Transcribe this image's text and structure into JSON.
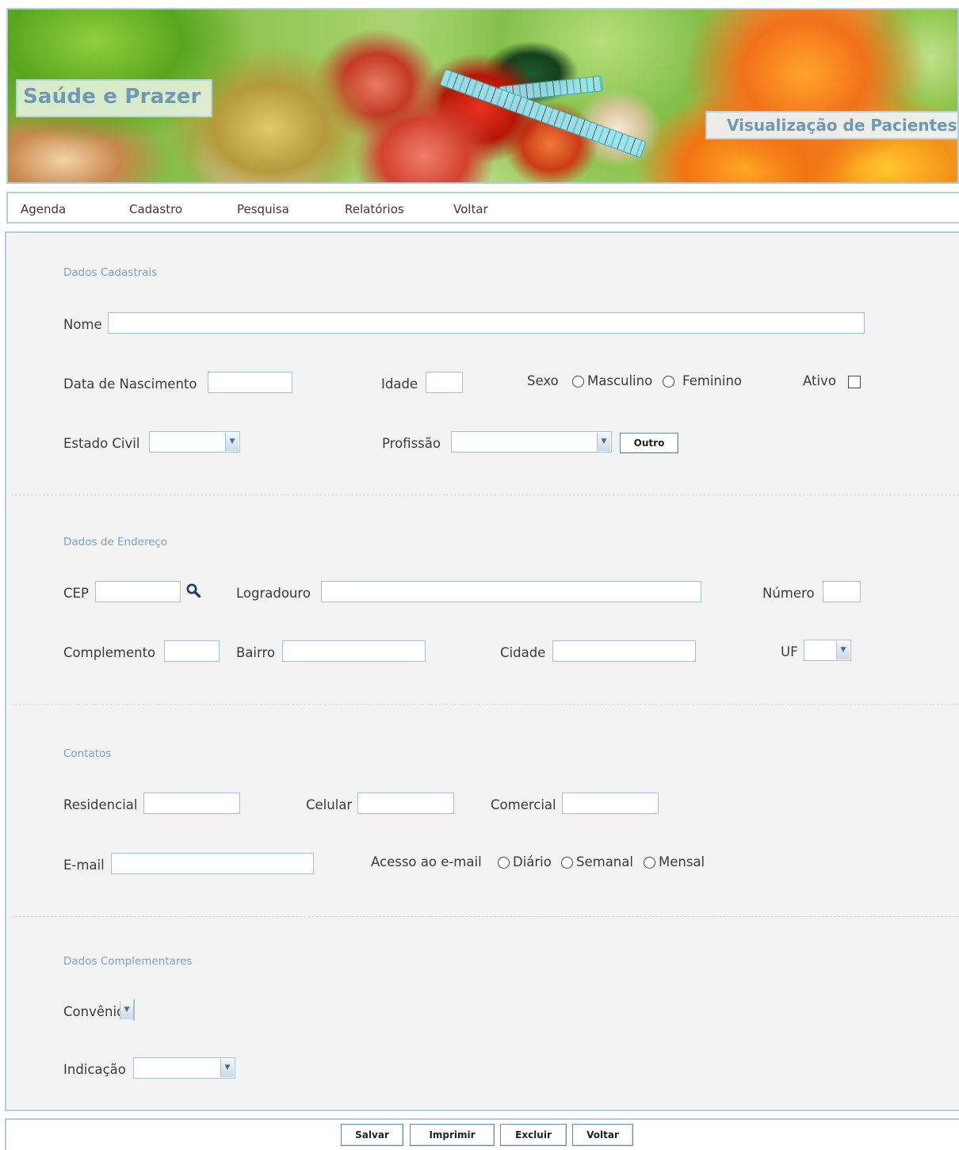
{
  "banner": {
    "brand": "Saúde e Prazer",
    "page_title": "Visualização de Pacientes"
  },
  "menu": {
    "items": [
      "Agenda",
      "Cadastro",
      "Pesquisa",
      "Relatórios",
      "Voltar"
    ]
  },
  "sections": {
    "cadastrais": {
      "title": "Dados Cadastrais",
      "nome_label": "Nome",
      "nome_value": "",
      "nascimento_label": "Data de Nascimento",
      "nascimento_value": "",
      "idade_label": "Idade",
      "idade_value": "",
      "sexo_label": "Sexo",
      "sexo_options": [
        "Masculino",
        "Feminino"
      ],
      "ativo_label": "Ativo",
      "estado_civil_label": "Estado Civil",
      "profissao_label": "Profissão",
      "outro_button": "Outro"
    },
    "endereco": {
      "title": "Dados de Endereço",
      "cep_label": "CEP",
      "logradouro_label": "Logradouro",
      "numero_label": "Número",
      "complemento_label": "Complemento",
      "bairro_label": "Bairro",
      "cidade_label": "Cidade",
      "uf_label": "UF"
    },
    "contatos": {
      "title": "Contatos",
      "residencial_label": "Residencial",
      "celular_label": "Celular",
      "comercial_label": "Comercial",
      "email_label": "E-mail",
      "acesso_label": "Acesso ao e-mail",
      "acesso_options": [
        "Diário",
        "Semanal",
        "Mensal"
      ]
    },
    "complementares": {
      "title": "Dados Complementares",
      "convenio_label": "Convênio",
      "indicacao_label": "Indicação"
    }
  },
  "actions": {
    "salvar": "Salvar",
    "imprimir": "Imprimir",
    "excluir": "Excluir",
    "voltar": "Voltar"
  },
  "icons": {
    "cep_search": "magnifier-icon",
    "dropdown": "chevron-down-icon"
  },
  "colors": {
    "accent": "#6f99b3",
    "section_title": "#7ba3c1",
    "border": "#b8cbd8",
    "panel_bg": "#f3f3f3"
  }
}
